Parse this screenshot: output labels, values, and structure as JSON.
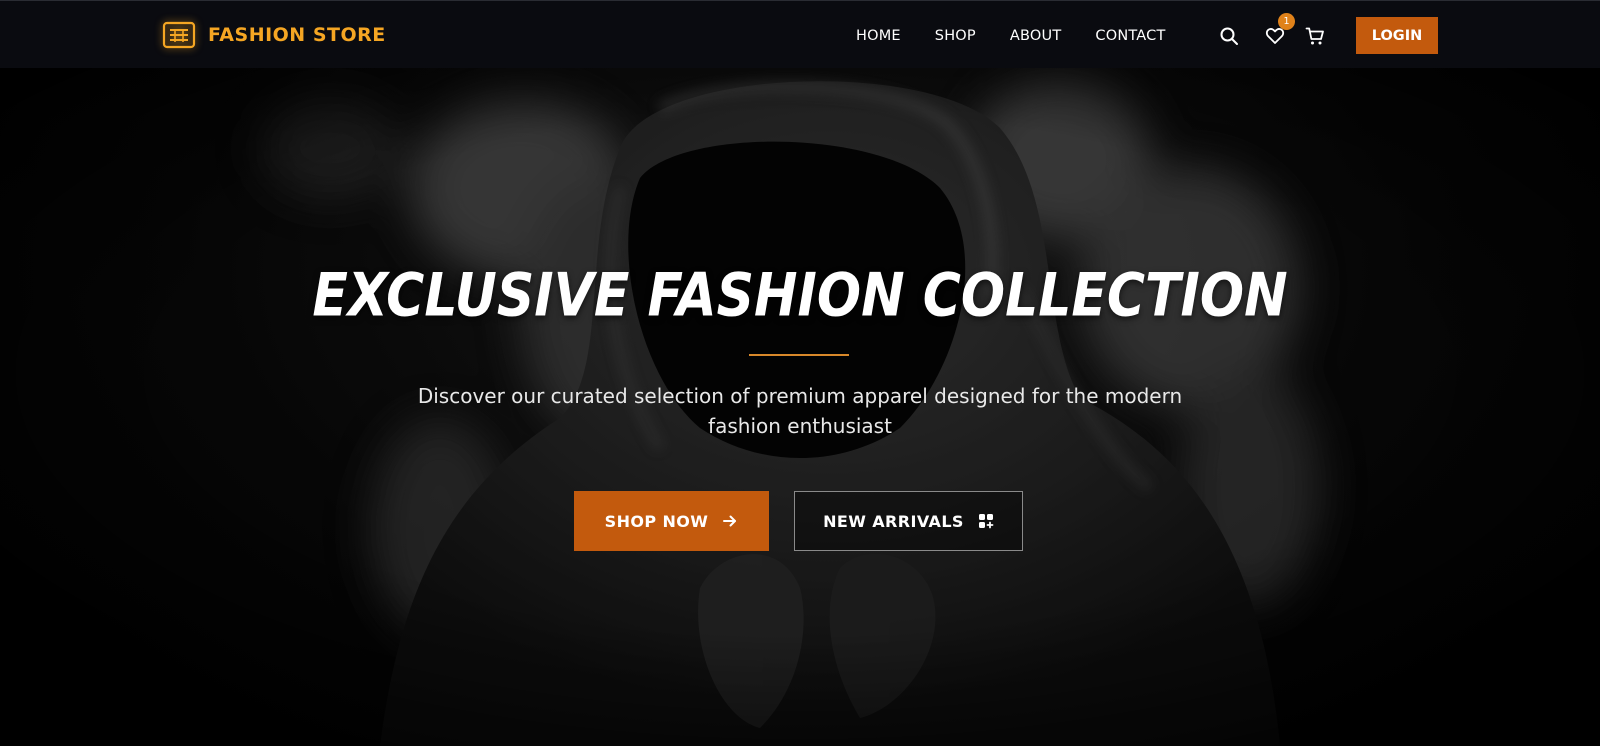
{
  "brand": {
    "name": "FASHION STORE",
    "icon": "store-logo-icon",
    "color": "#f5a623"
  },
  "nav": {
    "links": [
      "HOME",
      "SHOP",
      "ABOUT",
      "CONTACT"
    ],
    "icons": [
      "search-icon",
      "heart-icon",
      "cart-icon"
    ],
    "wishlist_count": "1",
    "login_label": "LOGIN"
  },
  "hero": {
    "title": "EXCLUSIVE FASHION COLLECTION",
    "subtitle": "Discover our curated selection of premium apparel designed for the modern fashion enthusiast",
    "primary_button": {
      "label": "SHOP NOW",
      "icon": "arrow-right-icon"
    },
    "secondary_button": {
      "label": "NEW ARRIVALS",
      "icon": "grid-icon"
    },
    "background": "hooded-figure-smoke-image"
  },
  "colors": {
    "accent": "#c35a0d",
    "accent_light": "#f5a623",
    "navbar_bg": "#0a0b10",
    "divider": "#d8882a"
  }
}
